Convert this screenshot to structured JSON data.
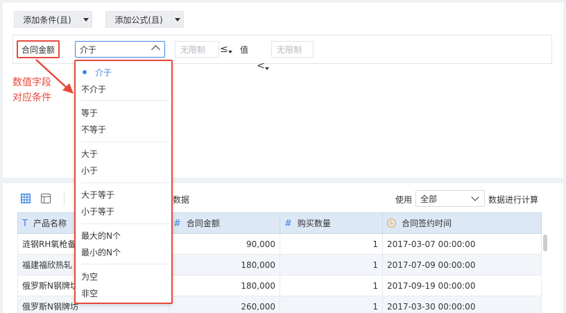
{
  "toolbar": {
    "add_condition_label": "添加条件(且)",
    "add_formula_label": "添加公式(且)"
  },
  "condition": {
    "field_label": "合同金额",
    "selected_operator": "介于",
    "min_placeholder": "无限制",
    "min_operator": "≤",
    "value_label": "值",
    "max_operator": "<",
    "max_placeholder": "无限制"
  },
  "annotation": {
    "line1": "数值字段",
    "line2": "对应条件"
  },
  "dropdown": {
    "groups": [
      [
        "介于",
        "不介于"
      ],
      [
        "等于",
        "不等于"
      ],
      [
        "大于",
        "小于"
      ],
      [
        "大于等于",
        "小于等于"
      ],
      [
        "最大的N个",
        "最小的N个"
      ],
      [
        "为空",
        "非空"
      ]
    ],
    "selected": "介于"
  },
  "preview": {
    "partial_label": "数据",
    "use_label": "使用",
    "use_select_value": "全部",
    "calc_label": "数据进行计算"
  },
  "table": {
    "columns": [
      {
        "icon": "T",
        "label": "产品名称"
      },
      {
        "icon": "#",
        "label": "合同金额"
      },
      {
        "icon": "#",
        "label": "购买数量"
      },
      {
        "icon": "clock",
        "label": "合同签约时间"
      }
    ],
    "rows": [
      [
        "涟钢RH氧枪备",
        "90,000",
        "1",
        "2017-03-07 00:00:00"
      ],
      [
        "福建福欣热轧",
        "180,000",
        "1",
        "2017-07-09 00:00:00"
      ],
      [
        "俄罗斯N钢牌坊",
        "180,000",
        "1",
        "2017-09-19 00:00:00"
      ],
      [
        "俄罗斯N钢牌坊",
        "260,000",
        "1",
        "2017-03-30 00:00:00"
      ]
    ]
  },
  "colors": {
    "accent": "#3f86e6",
    "highlight": "#e8483c",
    "header_bg": "#dde8f6"
  }
}
